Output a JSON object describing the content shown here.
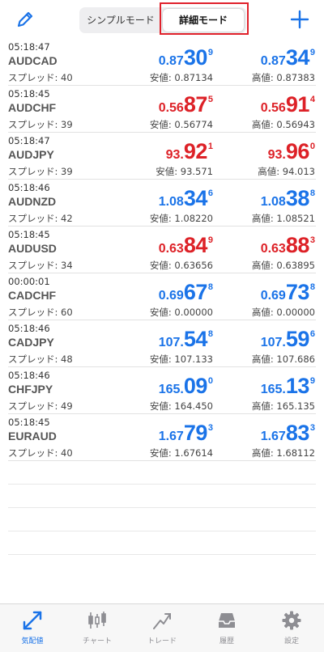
{
  "header": {
    "edit_icon": "pencil-icon",
    "segments": {
      "simple": "シンプルモード",
      "detail": "詳細モード",
      "selected": "詳細モード"
    },
    "add_icon": "plus-icon"
  },
  "colors": {
    "accent": "#1a73e8",
    "down": "#dd2127",
    "highlight": "#e0212b"
  },
  "quotes": [
    {
      "time": "05:18:47",
      "symbol": "AUDCAD",
      "spread": "スプレッド: 40",
      "bid": {
        "small": "0.87",
        "big": "30",
        "sup": "9"
      },
      "ask": {
        "small": "0.87",
        "big": "34",
        "sup": "9"
      },
      "low": "安値: 0.87134",
      "high": "高値: 0.87383",
      "color": "blue"
    },
    {
      "time": "05:18:45",
      "symbol": "AUDCHF",
      "spread": "スプレッド: 39",
      "bid": {
        "small": "0.56",
        "big": "87",
        "sup": "5"
      },
      "ask": {
        "small": "0.56",
        "big": "91",
        "sup": "4"
      },
      "low": "安値: 0.56774",
      "high": "高値: 0.56943",
      "color": "red"
    },
    {
      "time": "05:18:47",
      "symbol": "AUDJPY",
      "spread": "スプレッド: 39",
      "bid": {
        "small": "93.",
        "big": "92",
        "sup": "1"
      },
      "ask": {
        "small": "93.",
        "big": "96",
        "sup": "0"
      },
      "low": "安値: 93.571",
      "high": "高値: 94.013",
      "color": "red"
    },
    {
      "time": "05:18:46",
      "symbol": "AUDNZD",
      "spread": "スプレッド: 42",
      "bid": {
        "small": "1.08",
        "big": "34",
        "sup": "6"
      },
      "ask": {
        "small": "1.08",
        "big": "38",
        "sup": "8"
      },
      "low": "安値: 1.08220",
      "high": "高値: 1.08521",
      "color": "blue"
    },
    {
      "time": "05:18:45",
      "symbol": "AUDUSD",
      "spread": "スプレッド: 34",
      "bid": {
        "small": "0.63",
        "big": "84",
        "sup": "9"
      },
      "ask": {
        "small": "0.63",
        "big": "88",
        "sup": "3"
      },
      "low": "安値: 0.63656",
      "high": "高値: 0.63895",
      "color": "red"
    },
    {
      "time": "00:00:01",
      "symbol": "CADCHF",
      "spread": "スプレッド: 60",
      "bid": {
        "small": "0.69",
        "big": "67",
        "sup": "8"
      },
      "ask": {
        "small": "0.69",
        "big": "73",
        "sup": "8"
      },
      "low": "安値: 0.00000",
      "high": "高値: 0.00000",
      "color": "blue"
    },
    {
      "time": "05:18:46",
      "symbol": "CADJPY",
      "spread": "スプレッド: 48",
      "bid": {
        "small": "107.",
        "big": "54",
        "sup": "8"
      },
      "ask": {
        "small": "107.",
        "big": "59",
        "sup": "6"
      },
      "low": "安値: 107.133",
      "high": "高値: 107.686",
      "color": "blue"
    },
    {
      "time": "05:18:46",
      "symbol": "CHFJPY",
      "spread": "スプレッド: 49",
      "bid": {
        "small": "165.",
        "big": "09",
        "sup": "0"
      },
      "ask": {
        "small": "165.",
        "big": "13",
        "sup": "9"
      },
      "low": "安値: 164.450",
      "high": "高値: 165.135",
      "color": "blue"
    },
    {
      "time": "05:18:45",
      "symbol": "EURAUD",
      "spread": "スプレッド: 40",
      "bid": {
        "small": "1.67",
        "big": "79",
        "sup": "3"
      },
      "ask": {
        "small": "1.67",
        "big": "83",
        "sup": "3"
      },
      "low": "安値: 1.67614",
      "high": "高値: 1.68112",
      "color": "blue"
    }
  ],
  "tabs": [
    {
      "label": "気配値",
      "icon": "quotes-icon",
      "active": true
    },
    {
      "label": "チャート",
      "icon": "candlestick-chart-icon",
      "active": false
    },
    {
      "label": "トレード",
      "icon": "trade-trend-icon",
      "active": false
    },
    {
      "label": "履歴",
      "icon": "history-inbox-icon",
      "active": false
    },
    {
      "label": "設定",
      "icon": "settings-gear-icon",
      "active": false
    }
  ]
}
